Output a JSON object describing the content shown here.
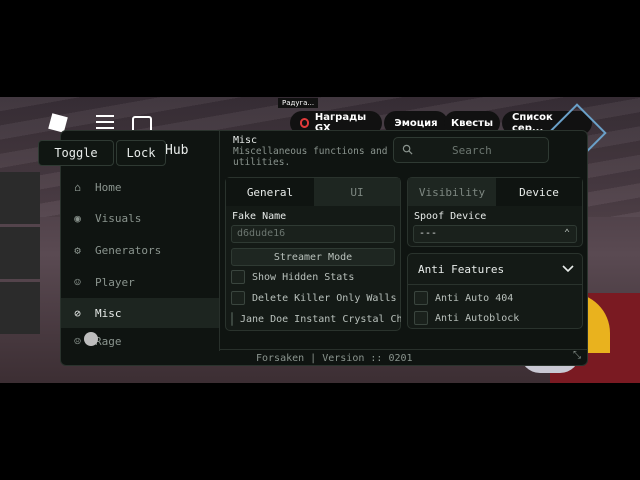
{
  "game": {
    "notice": "Радуга... ",
    "rewards": "Награды GX",
    "emotion": "Эмоция",
    "quests": "Квесты",
    "list": "Список сер..."
  },
  "overlay": {
    "toggle_label": "Toggle",
    "lock_label": "Lock"
  },
  "window": {
    "title": "Hub",
    "section_title": "Misc",
    "section_subtitle": "Miscellaneous functions and utilities.",
    "search_placeholder": "Search",
    "footer": "Forsaken | Version :: 0201"
  },
  "sidebar": {
    "items": [
      {
        "label": "Home",
        "icon": "home-icon"
      },
      {
        "label": "Visuals",
        "icon": "eye-icon"
      },
      {
        "label": "Generators",
        "icon": "gear-icon"
      },
      {
        "label": "Player",
        "icon": "user-icon"
      },
      {
        "label": "Misc",
        "icon": "paperclip-icon",
        "active": true
      },
      {
        "label": "Rage",
        "icon": "frown-icon"
      }
    ]
  },
  "left_panel": {
    "tabs": [
      {
        "label": "General",
        "active": true
      },
      {
        "label": "UI",
        "active": false
      }
    ],
    "fake_name_label": "Fake Name",
    "fake_name_placeholder": "d6dude16",
    "streamer_button": "Streamer Mode",
    "toggles": [
      {
        "label": "Show Hidden Stats",
        "checked": false
      },
      {
        "label": "Delete Killer Only Walls",
        "checked": false
      },
      {
        "label": "Jane Doe Instant Crystal Cha",
        "checked": false
      }
    ]
  },
  "right_panel": {
    "tabs": [
      {
        "label": "Visibility",
        "active": false
      },
      {
        "label": "Device",
        "active": true
      }
    ],
    "spoof_label": "Spoof Device",
    "spoof_value": "---",
    "anti_title": "Anti Features",
    "anti_toggles": [
      {
        "label": "Anti Auto 404",
        "checked": false
      },
      {
        "label": "Anti Autoblock",
        "checked": false
      }
    ]
  },
  "colors": {
    "panel_bg": "#0f1411",
    "accent_text": "#e8ecea",
    "muted_text": "#8a948e"
  }
}
